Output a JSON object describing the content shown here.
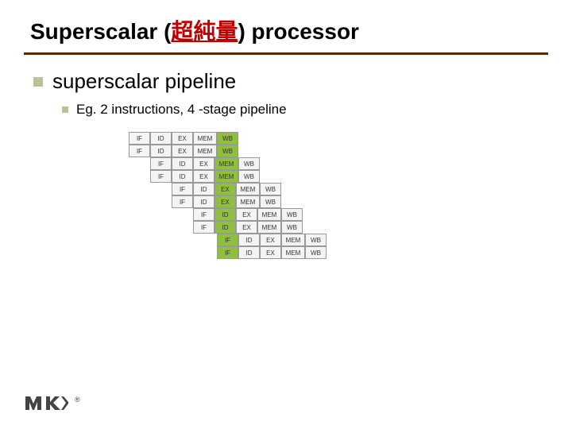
{
  "title": {
    "pre": "Superscalar (",
    "cjk1": "超",
    "cjk2": "純量",
    "post": ") processor"
  },
  "bullets": {
    "lvl1": "superscalar pipeline",
    "lvl2": "Eg. 2 instructions, 4 -stage pipeline"
  },
  "pipeline": {
    "stages": [
      "IF",
      "ID",
      "EX",
      "MEM",
      "WB"
    ],
    "rows": [
      {
        "offset": 0,
        "hi": 4
      },
      {
        "offset": 0,
        "hi": 4
      },
      {
        "offset": 1,
        "hi": 3
      },
      {
        "offset": 1,
        "hi": 3
      },
      {
        "offset": 2,
        "hi": 2
      },
      {
        "offset": 2,
        "hi": 2
      },
      {
        "offset": 3,
        "hi": 1
      },
      {
        "offset": 3,
        "hi": 1
      },
      {
        "offset": 4,
        "hi": 0
      },
      {
        "offset": 4,
        "hi": 0
      }
    ]
  },
  "logo": {
    "reg": "®"
  }
}
